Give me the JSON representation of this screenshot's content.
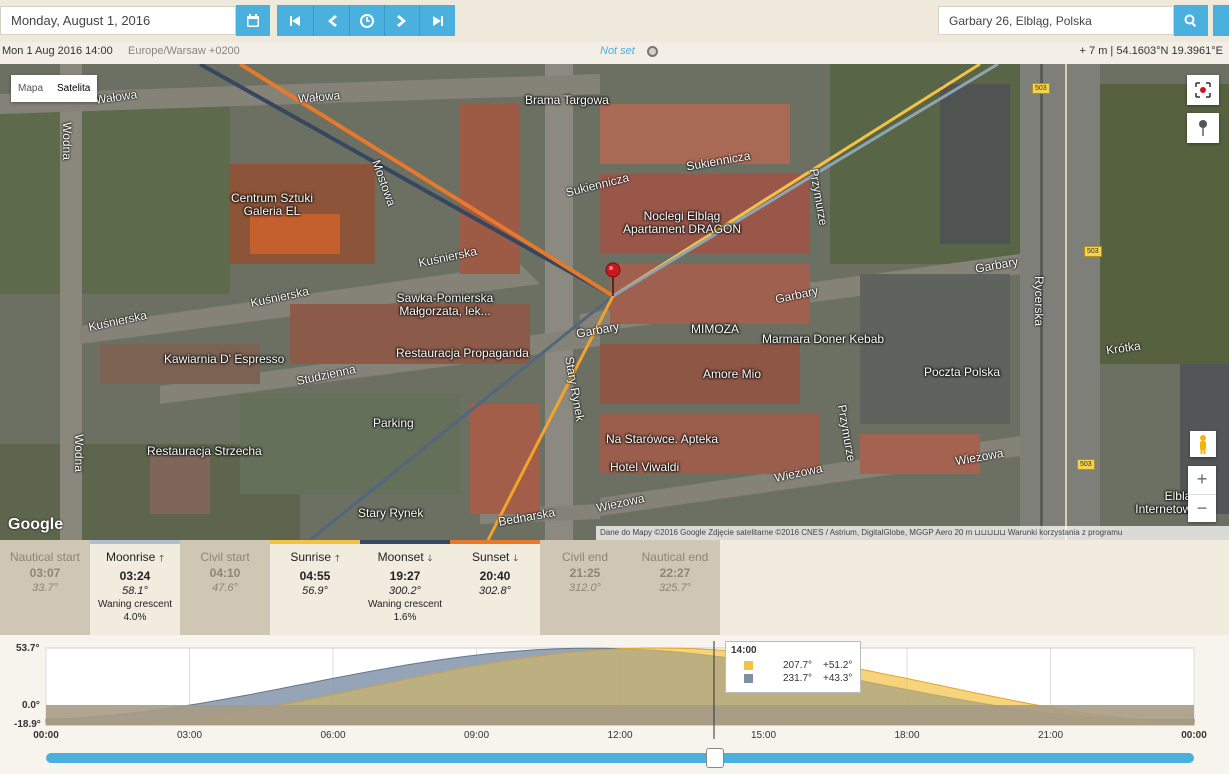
{
  "toolbar": {
    "date_value": "Monday, August 1, 2016",
    "location_value": "Garbary 26, Elbląg, Polska"
  },
  "info": {
    "datetime": "Mon 1 Aug 2016 14:00",
    "timezone": "Europe/Warsaw +0200",
    "not_set": "Not set",
    "coords": "+ 7 m | 54.1603°N 19.3961°E"
  },
  "map": {
    "type_map": "Mapa",
    "type_satellite": "Satelita",
    "google": "Google",
    "attribution": "Dane do Mapy ©2016 Google Zdjęcie satelitarne ©2016 CNES / Astrium, DigitalGlobe, MGGP Aero   20 m ⊔⊔⊔⊔⊔   Warunki korzystania z programu",
    "places": [
      "Brama Targowa",
      "Centrum Sztuki Galeria EL",
      "Noclegi Elbląg Apartament DRAGON",
      "Sawka-Pomierska Małgorzata, lek...",
      "Restauracja Propaganda",
      "MIMOZA",
      "Marmara Doner Kebab",
      "Amore Mio",
      "Poczta Polska",
      "Kawiarnia D' Espresso",
      "Parking",
      "Restauracja Strzecha",
      "Na Starówce. Apteka",
      "Hotel Viwaldi",
      "Stary Rynek",
      "Elbląg Internetowa"
    ],
    "streets": [
      "Wałowa",
      "Wałowa",
      "Wodna",
      "Wodna",
      "Mostowa",
      "Kuśnierska",
      "Kuśnierska",
      "Kuśnierska",
      "Studzienna",
      "Sukiennicza",
      "Sukiennicza",
      "Garbary",
      "Garbary",
      "Garbary",
      "Rycerska",
      "Krótka",
      "Stary Rynek",
      "Przymurze",
      "Przymurze",
      "Wieżowa",
      "Wieżowa",
      "Wieżowa",
      "Bednarska"
    ],
    "road_signs": [
      "503",
      "503",
      "503"
    ]
  },
  "events": [
    {
      "name": "Nautical start",
      "time": "03:07",
      "az": "33.7°",
      "phase": "",
      "arrow": "",
      "style": "dim",
      "bar": ""
    },
    {
      "name": "Moonrise",
      "time": "03:24",
      "az": "58.1°",
      "phase": "Waning crescent",
      "pct": "4.0%",
      "arrow": "🡑",
      "style": "hi",
      "bar": "#aebfd0"
    },
    {
      "name": "Civil start",
      "time": "04:10",
      "az": "47.6°",
      "phase": "",
      "arrow": "",
      "style": "dim",
      "bar": ""
    },
    {
      "name": "Sunrise",
      "time": "04:55",
      "az": "56.9°",
      "phase": "",
      "arrow": "🡑",
      "style": "hi",
      "bar": "#f2c244"
    },
    {
      "name": "Moonset",
      "time": "19:27",
      "az": "300.2°",
      "phase": "Waning crescent",
      "pct": "1.6%",
      "arrow": "🡓",
      "style": "hi",
      "bar": "#36475f"
    },
    {
      "name": "Sunset",
      "time": "20:40",
      "az": "302.8°",
      "phase": "",
      "arrow": "🡓",
      "style": "hi",
      "bar": "#e8782b"
    },
    {
      "name": "Civil end",
      "time": "21:25",
      "az": "312.0°",
      "phase": "",
      "arrow": "",
      "style": "dim",
      "bar": ""
    },
    {
      "name": "Nautical end",
      "time": "22:27",
      "az": "325.7°",
      "phase": "",
      "arrow": "",
      "style": "dim",
      "bar": ""
    }
  ],
  "graph": {
    "ymax": "53.7°",
    "yzero": "0.0°",
    "ymin": "-18.9°",
    "xticks": [
      "00:00",
      "03:00",
      "06:00",
      "09:00",
      "12:00",
      "15:00",
      "18:00",
      "21:00",
      "00:00"
    ],
    "tooltip_title": "14:00",
    "sun_az": "207.7°",
    "sun_alt": "+51.2°",
    "moon_az": "231.7°",
    "moon_alt": "+43.3°",
    "slider_fraction": 0.583
  },
  "colors": {
    "accent": "#4ab0de",
    "sun": "#f2c244",
    "moon": "#7f8fa8",
    "sunset": "#e8782b",
    "moonset": "#36475f"
  }
}
